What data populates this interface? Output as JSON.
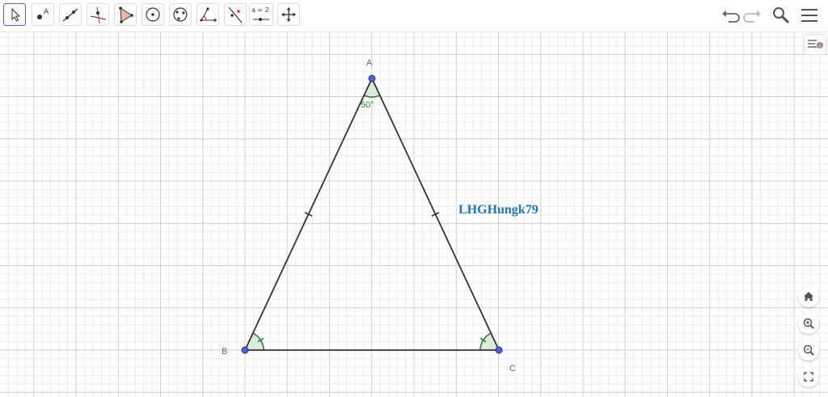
{
  "toolbar": {
    "tools": [
      {
        "name": "move-tool",
        "icon": "arrow-pointer-icon"
      },
      {
        "name": "point-tool",
        "icon": "point-icon"
      },
      {
        "name": "line-tool",
        "icon": "line-through-points-icon"
      },
      {
        "name": "perpendicular-tool",
        "icon": "perpendicular-line-icon"
      },
      {
        "name": "polygon-tool",
        "icon": "polygon-icon"
      },
      {
        "name": "circle-tool",
        "icon": "circle-center-icon"
      },
      {
        "name": "circle-three-points-tool",
        "icon": "circle-three-points-icon"
      },
      {
        "name": "angle-tool",
        "icon": "angle-icon"
      },
      {
        "name": "reflect-tool",
        "icon": "reflect-about-line-icon"
      },
      {
        "name": "slider-tool",
        "icon": "slider-icon",
        "text": "a = 2"
      },
      {
        "name": "move-graphics-view-tool",
        "icon": "move-arrows-icon"
      }
    ],
    "right_icons": [
      "undo-icon",
      "redo-icon",
      "search-icon",
      "menu-icon"
    ]
  },
  "colors": {
    "point_fill": "#4f5fe0",
    "segment": "#333333",
    "angle_stroke": "#2e7d32",
    "angle_fill": "#d8ecd8",
    "label": "#5a5fb0",
    "watermark": "#1e73be",
    "grid_major": "#cfcfcf",
    "grid_minor": "#ececec"
  },
  "points": {
    "A": {
      "label": "A"
    },
    "B": {
      "label": "B"
    },
    "C": {
      "label": "C"
    }
  },
  "angle_A": {
    "label": "50°"
  },
  "watermark": {
    "text": "LHGHungk79"
  },
  "zoom_panel": {
    "icons": [
      "home-icon",
      "zoom-in-icon",
      "zoom-out-icon",
      "fullscreen-icon"
    ]
  },
  "style_bar": {
    "icon": "style-bar-toggle-icon"
  }
}
